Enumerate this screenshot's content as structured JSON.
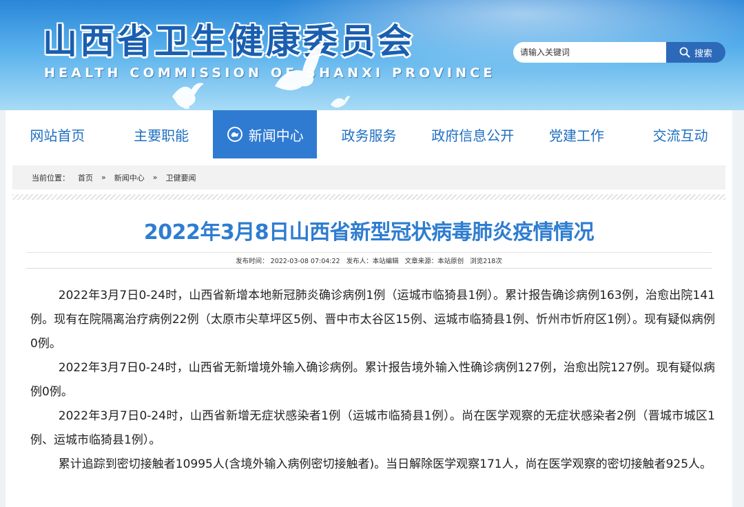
{
  "header": {
    "title": "山西省卫生健康委员会",
    "subtitle": "HEALTH COMMISSION OF SHANXI PROVINCE"
  },
  "search": {
    "placeholder": "请输入关键词",
    "button_label": "搜索"
  },
  "nav": {
    "items": [
      "网站首页",
      "主要职能",
      "新闻中心",
      "政务服务",
      "政府信息公开",
      "党建工作",
      "交流互动"
    ],
    "active_index": 2
  },
  "breadcrumb": {
    "label": "当前位置：",
    "items": [
      "首页",
      "新闻中心",
      "卫健要闻"
    ],
    "separator": "»"
  },
  "article": {
    "title": "2022年3月8日山西省新型冠状病毒肺炎疫情情况",
    "meta": {
      "publish_time": "发布时间： 2022-03-08 07:04:22",
      "publisher": "发布人：本站编辑",
      "source": "文章来源：本站原创",
      "views": "浏览218次"
    },
    "paragraphs": [
      "2022年3月7日0-24时，山西省新增本地新冠肺炎确诊病例1例（运城市临猗县1例）。累计报告确诊病例163例，治愈出院141例。现有在院隔离治疗病例22例（太原市尖草坪区5例、晋中市太谷区15例、运城市临猗县1例、忻州市忻府区1例）。现有疑似病例0例。",
      "2022年3月7日0-24时，山西省无新增境外输入确诊病例。累计报告境外输入性确诊病例127例，治愈出院127例。现有疑似病例0例。",
      "2022年3月7日0-24时，山西省新增无症状感染者1例（运城市临猗县1例）。尚在医学观察的无症状感染者2例（晋城市城区1例、运城市临猗县1例）。",
      "累计追踪到密切接触者10995人(含境外输入病例密切接触者)。当日解除医学观察171人，尚在医学观察的密切接触者925人。"
    ]
  },
  "colors": {
    "brand_blue": "#2f7bd2",
    "title_blue": "#2e7dd0",
    "search_button": "#2c69b8"
  }
}
